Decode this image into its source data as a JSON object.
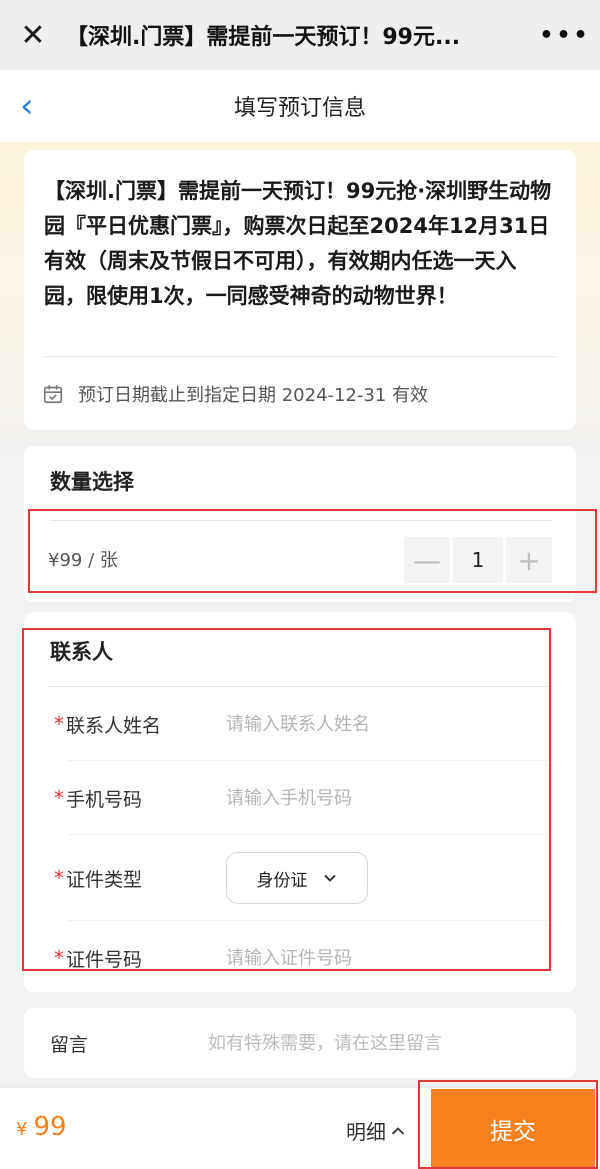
{
  "window": {
    "close_glyph": "✕",
    "title": "【深圳.门票】需提前一天预订！99元...",
    "more_glyph": "•••"
  },
  "nav": {
    "back_glyph": "‹",
    "title": "填写预订信息"
  },
  "product": {
    "title": "【深圳.门票】需提前一天预订！99元抢·深圳野生动物园『平日优惠门票』，购票次日起至2024年12月31日有效（周末及节假日不可用），有效期内任选一天入园，限使用1次，一同感受神奇的动物世界！",
    "validity_text": "预订日期截止到指定日期 2024-12-31 有效",
    "validity_icon": "calendar-check-icon"
  },
  "quantity": {
    "heading": "数量选择",
    "unit_price": "¥99 / 张",
    "minus_glyph": "—",
    "value": "1",
    "plus_glyph": "+"
  },
  "contact": {
    "heading": "联系人",
    "required_mark": "*",
    "fields": [
      {
        "label": "联系人姓名",
        "placeholder": "请输入联系人姓名",
        "value": ""
      },
      {
        "label": "手机号码",
        "placeholder": "请输入手机号码",
        "value": ""
      },
      {
        "label": "证件类型",
        "selected": "身份证"
      },
      {
        "label": "证件号码",
        "placeholder": "请输入证件号码",
        "value": ""
      }
    ]
  },
  "message": {
    "label": "留言",
    "placeholder": "如有特殊需要，请在这里留言"
  },
  "footer": {
    "currency": "¥",
    "total": "99",
    "detail_label": "明细",
    "submit_label": "提交"
  },
  "colors": {
    "accent_orange": "#f7811d",
    "link_blue": "#2a7ed6",
    "required_red": "#e0393b",
    "annotation_red": "#e0393b"
  }
}
